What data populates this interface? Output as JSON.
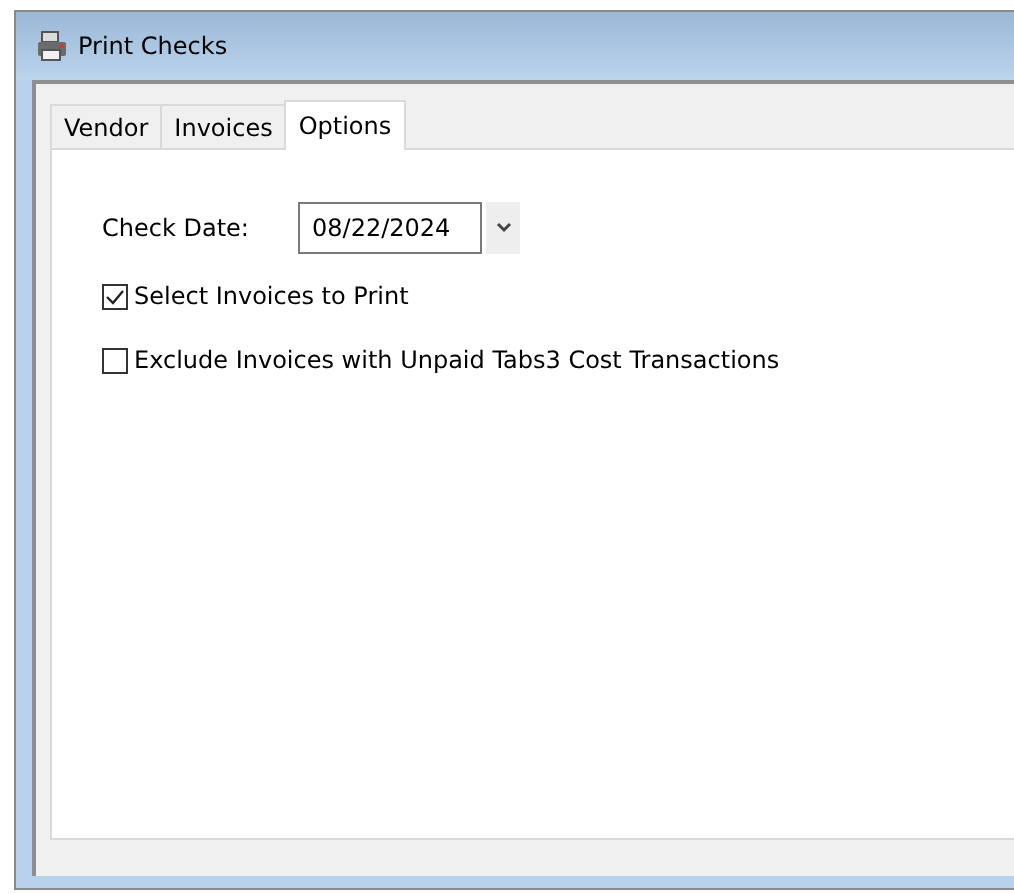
{
  "window": {
    "title": "Print Checks"
  },
  "tabs": [
    {
      "label": "Vendor",
      "selected": false
    },
    {
      "label": "Invoices",
      "selected": false
    },
    {
      "label": "Options",
      "selected": true
    }
  ],
  "check_date": {
    "label": "Check Date:",
    "value": "08/22/2024"
  },
  "options": [
    {
      "label": "Select Invoices to Print",
      "checked": true
    },
    {
      "label": "Exclude Invoices with Unpaid Tabs3 Cost Transactions",
      "checked": false
    }
  ]
}
